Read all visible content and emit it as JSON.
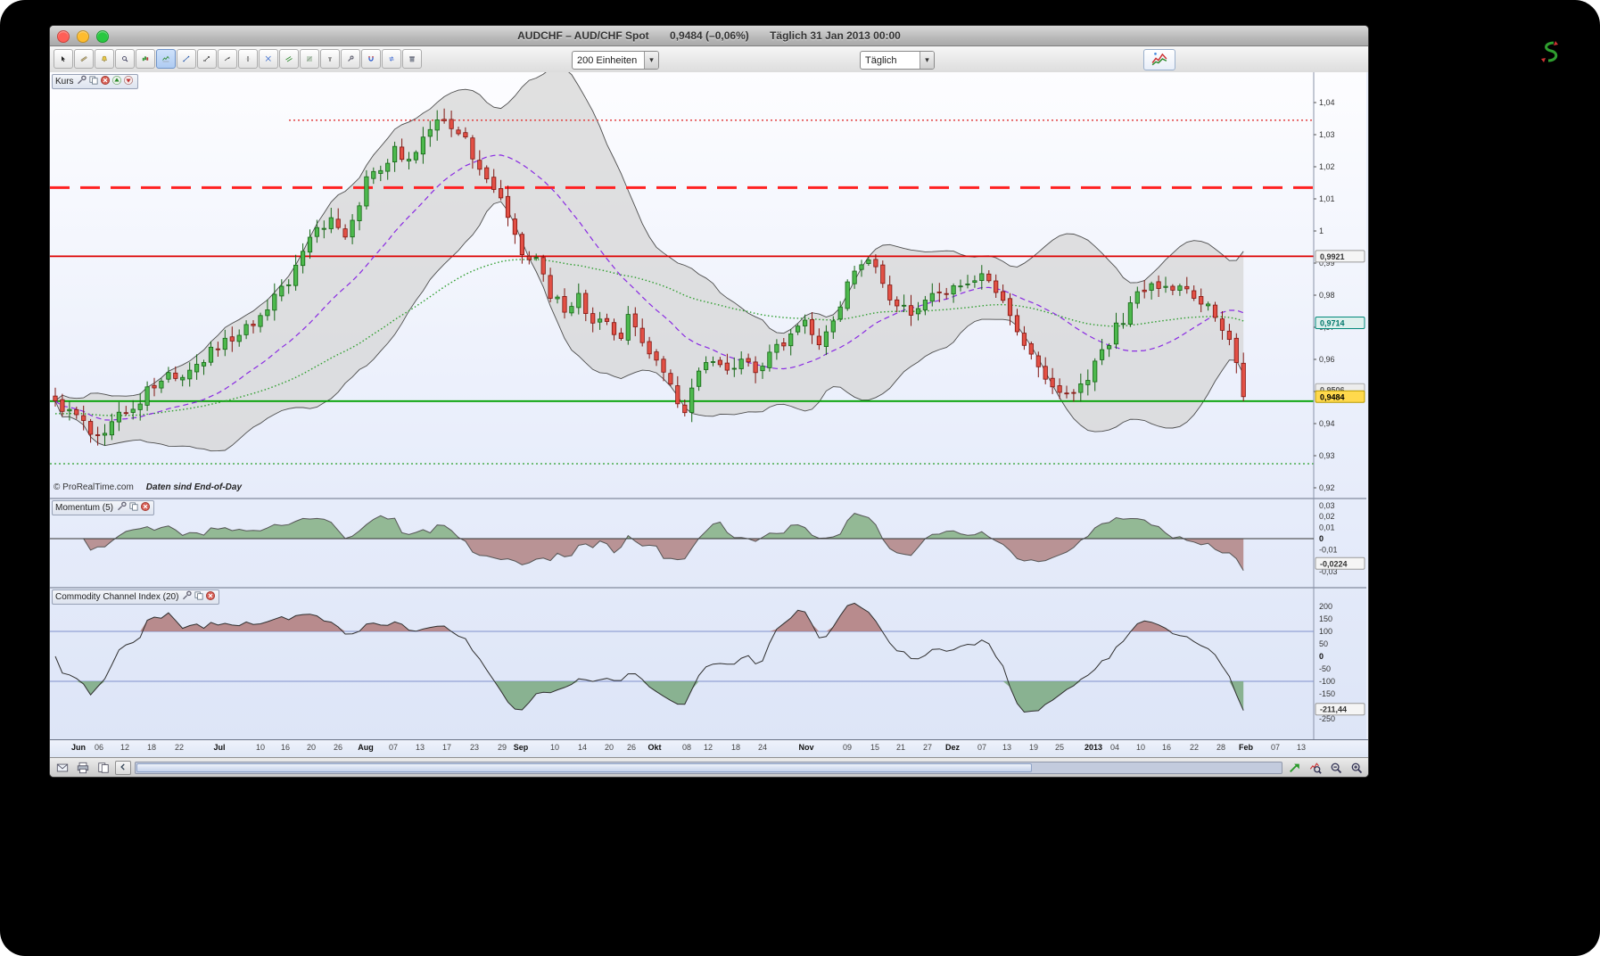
{
  "window": {
    "title_symbol": "AUDCHF – AUD/CHF Spot",
    "title_price": "0,9484 (–0,06%)",
    "title_timeframe": "Täglich  31 Jan 2013 00:00"
  },
  "toolbar": {
    "units_value": "200 Einheiten",
    "timeframe_value": "Täglich",
    "icons": [
      {
        "name": "cursor"
      },
      {
        "name": "measure"
      },
      {
        "name": "alert"
      },
      {
        "name": "zoom"
      },
      {
        "name": "pattern"
      },
      {
        "name": "indicator",
        "active": true
      },
      {
        "name": "trend-line"
      },
      {
        "name": "segment"
      },
      {
        "name": "ray"
      },
      {
        "name": "vertical-line"
      },
      {
        "name": "cross-lines"
      },
      {
        "name": "channel"
      },
      {
        "name": "fibonacci"
      },
      {
        "name": "text"
      },
      {
        "name": "tools"
      },
      {
        "name": "magnet"
      },
      {
        "name": "sync"
      },
      {
        "name": "delete"
      }
    ]
  },
  "panels": {
    "kurs": {
      "label": "Kurs",
      "icons": [
        "wrench-small",
        "copy-small",
        "close-small",
        "up-small",
        "down-small"
      ]
    },
    "momentum": {
      "label": "Momentum (5)",
      "icons": [
        "wrench-small",
        "copy-small",
        "close-small"
      ]
    },
    "cci": {
      "label": "Commodity Channel Index (20)",
      "icons": [
        "wrench-small",
        "copy-small",
        "close-small"
      ]
    }
  },
  "watermark": {
    "copyright": "© ProRealTime.com",
    "note": "Daten sind End-of-Day"
  },
  "statusbar": {
    "left_icons": [
      "envelope",
      "printer",
      "pages"
    ],
    "right_icons": [
      "green-arrow",
      "chart-zoom",
      "zoom-out",
      "zoom-in"
    ]
  },
  "chart_data": {
    "type": "candlestick",
    "symbol": "AUD/CHF Spot",
    "timeframe": "Täglich",
    "last_close": 0.9484,
    "bars": 169,
    "close_anchors": [
      [
        0,
        0.947
      ],
      [
        2,
        0.944
      ],
      [
        5,
        0.938
      ],
      [
        7,
        0.9365
      ],
      [
        9,
        0.942
      ],
      [
        12,
        0.948
      ],
      [
        15,
        0.955
      ],
      [
        18,
        0.956
      ],
      [
        20,
        0.959
      ],
      [
        23,
        0.964
      ],
      [
        26,
        0.968
      ],
      [
        28,
        0.97
      ],
      [
        30,
        0.976
      ],
      [
        33,
        0.985
      ],
      [
        35,
        0.993
      ],
      [
        37,
        1.0
      ],
      [
        39,
        1.005
      ],
      [
        41,
        0.998
      ],
      [
        44,
        1.015
      ],
      [
        46,
        1.02
      ],
      [
        48,
        1.025
      ],
      [
        50,
        1.022
      ],
      [
        52,
        1.03
      ],
      [
        54,
        1.034
      ],
      [
        56,
        1.032
      ],
      [
        58,
        1.028
      ],
      [
        60,
        1.018
      ],
      [
        62,
        1.012
      ],
      [
        64,
        1.005
      ],
      [
        66,
        0.993
      ],
      [
        68,
        0.99
      ],
      [
        70,
        0.98
      ],
      [
        72,
        0.976
      ],
      [
        74,
        0.979
      ],
      [
        76,
        0.97
      ],
      [
        78,
        0.972
      ],
      [
        80,
        0.966
      ],
      [
        81,
        0.973
      ],
      [
        84,
        0.963
      ],
      [
        86,
        0.956
      ],
      [
        88,
        0.947
      ],
      [
        89,
        0.944
      ],
      [
        91,
        0.956
      ],
      [
        93,
        0.96
      ],
      [
        95,
        0.957
      ],
      [
        97,
        0.959
      ],
      [
        99,
        0.956
      ],
      [
        101,
        0.961
      ],
      [
        103,
        0.965
      ],
      [
        105,
        0.969
      ],
      [
        106,
        0.972
      ],
      [
        108,
        0.965
      ],
      [
        110,
        0.971
      ],
      [
        112,
        0.985
      ],
      [
        114,
        0.99
      ],
      [
        115,
        0.992
      ],
      [
        117,
        0.983
      ],
      [
        119,
        0.976
      ],
      [
        121,
        0.975
      ],
      [
        123,
        0.978
      ],
      [
        125,
        0.98
      ],
      [
        127,
        0.982
      ],
      [
        129,
        0.985
      ],
      [
        131,
        0.986
      ],
      [
        133,
        0.98
      ],
      [
        134,
        0.977
      ],
      [
        136,
        0.97
      ],
      [
        138,
        0.96
      ],
      [
        140,
        0.953
      ],
      [
        142,
        0.948
      ],
      [
        144,
        0.95
      ],
      [
        146,
        0.953
      ],
      [
        147,
        0.96
      ],
      [
        149,
        0.965
      ],
      [
        150,
        0.97
      ],
      [
        152,
        0.976
      ],
      [
        153,
        0.98
      ],
      [
        155,
        0.984
      ],
      [
        157,
        0.983
      ],
      [
        159,
        0.982
      ],
      [
        161,
        0.98
      ],
      [
        163,
        0.976
      ],
      [
        164,
        0.972
      ],
      [
        166,
        0.968
      ],
      [
        167,
        0.96
      ],
      [
        168,
        0.9484
      ]
    ],
    "indicators": {
      "bollinger_period": 20,
      "bollinger_mult": 2.1,
      "slow_ma_period": 70,
      "momentum_period": 5,
      "cci_period": 20
    },
    "hlines": [
      {
        "value": 1.0345,
        "style": "dotted",
        "color": "#e03030",
        "width": 1.4,
        "from_frac": 0.19
      },
      {
        "value": 1.0135,
        "style": "dashed",
        "color": "#ff2222",
        "width": 3,
        "from_frac": 0
      },
      {
        "value": 0.9921,
        "style": "solid",
        "color": "#dd0000",
        "width": 1.8,
        "from_frac": 0
      },
      {
        "value": 0.947,
        "style": "solid",
        "color": "#00a000",
        "width": 1.8,
        "from_frac": 0
      },
      {
        "value": 0.9275,
        "style": "dotted",
        "color": "#2aa02a",
        "width": 1.2,
        "from_frac": 0
      }
    ],
    "price_axis": {
      "ticks": [
        {
          "t": "1,04",
          "v": 1.04
        },
        {
          "t": "1,03",
          "v": 1.03
        },
        {
          "t": "1,02",
          "v": 1.02
        },
        {
          "t": "1,01",
          "v": 1.01
        },
        {
          "t": "1",
          "v": 1.0
        },
        {
          "t": "0,99",
          "v": 0.99
        },
        {
          "t": "0,98",
          "v": 0.98
        },
        {
          "t": "0,97",
          "v": 0.97
        },
        {
          "t": "0,96",
          "v": 0.96
        },
        {
          "t": "0,95",
          "v": 0.95
        },
        {
          "t": "0,94",
          "v": 0.94
        },
        {
          "t": "0,93",
          "v": 0.93
        },
        {
          "t": "0,92",
          "v": 0.92
        }
      ],
      "badges": [
        {
          "text": "0,9921",
          "value": 0.9921,
          "bg": "#f5f5f5",
          "fg": "#333",
          "border": "#999"
        },
        {
          "text": "0,9714",
          "value": 0.9714,
          "bg": "#def0ed",
          "fg": "#00776b",
          "border": "#00887a"
        },
        {
          "text": "0,9506",
          "value": 0.9506,
          "bg": "#ededed",
          "fg": "#555",
          "border": "#aaa"
        },
        {
          "text": "0,9484",
          "value": 0.9484,
          "bg": "#ffd94d",
          "fg": "#000",
          "border": "#b89a00"
        }
      ]
    },
    "momentum_axis": {
      "ticks": [
        {
          "t": "0,03",
          "v": 0.03
        },
        {
          "t": "0,02",
          "v": 0.02
        },
        {
          "t": "0,01",
          "v": 0.01
        },
        {
          "t": "0",
          "v": 0,
          "bold": true
        },
        {
          "t": "-0,01",
          "v": -0.01
        },
        {
          "t": "-0,02",
          "v": -0.02
        },
        {
          "t": "-0,03",
          "v": -0.03
        }
      ],
      "badge": {
        "text": "-0,0224",
        "value": -0.0224,
        "bg": "#f5f5f5",
        "fg": "#333",
        "border": "#999"
      }
    },
    "cci_axis": {
      "ticks": [
        {
          "t": "200",
          "v": 200
        },
        {
          "t": "150",
          "v": 150
        },
        {
          "t": "100",
          "v": 100
        },
        {
          "t": "50",
          "v": 50
        },
        {
          "t": "0",
          "v": 0,
          "bold": true
        },
        {
          "t": "-50",
          "v": -50
        },
        {
          "t": "-100",
          "v": -100
        },
        {
          "t": "-150",
          "v": -150
        },
        {
          "t": "-250",
          "v": -250
        }
      ],
      "badge": {
        "text": "-211,44",
        "value": -211.44,
        "bg": "#f5f5f5",
        "fg": "#333",
        "border": "#999"
      },
      "guide_lines": [
        100,
        -100
      ]
    },
    "x_axis": {
      "labels": [
        {
          "t": "Jun",
          "f": 0.02,
          "b": true
        },
        {
          "t": "06",
          "f": 0.036
        },
        {
          "t": "12",
          "f": 0.057
        },
        {
          "t": "18",
          "f": 0.078
        },
        {
          "t": "22",
          "f": 0.1
        },
        {
          "t": "Jul",
          "f": 0.132,
          "b": true
        },
        {
          "t": "10",
          "f": 0.164
        },
        {
          "t": "16",
          "f": 0.184
        },
        {
          "t": "20",
          "f": 0.205
        },
        {
          "t": "26",
          "f": 0.226
        },
        {
          "t": "Aug",
          "f": 0.248,
          "b": true
        },
        {
          "t": "07",
          "f": 0.27
        },
        {
          "t": "13",
          "f": 0.291
        },
        {
          "t": "17",
          "f": 0.312
        },
        {
          "t": "23",
          "f": 0.334
        },
        {
          "t": "29",
          "f": 0.356
        },
        {
          "t": "Sep",
          "f": 0.371,
          "b": true
        },
        {
          "t": "10",
          "f": 0.398
        },
        {
          "t": "14",
          "f": 0.42
        },
        {
          "t": "20",
          "f": 0.441
        },
        {
          "t": "26",
          "f": 0.459
        },
        {
          "t": "Okt",
          "f": 0.477,
          "b": true
        },
        {
          "t": "08",
          "f": 0.503
        },
        {
          "t": "12",
          "f": 0.52
        },
        {
          "t": "18",
          "f": 0.542
        },
        {
          "t": "24",
          "f": 0.563
        },
        {
          "t": "Nov",
          "f": 0.598,
          "b": true
        },
        {
          "t": "09",
          "f": 0.63
        },
        {
          "t": "15",
          "f": 0.652
        },
        {
          "t": "21",
          "f": 0.673
        },
        {
          "t": "27",
          "f": 0.694
        },
        {
          "t": "Dez",
          "f": 0.714,
          "b": true
        },
        {
          "t": "07",
          "f": 0.737
        },
        {
          "t": "13",
          "f": 0.757
        },
        {
          "t": "19",
          "f": 0.778
        },
        {
          "t": "25",
          "f": 0.799
        },
        {
          "t": "2013",
          "f": 0.826,
          "b": true
        },
        {
          "t": "04",
          "f": 0.843
        },
        {
          "t": "10",
          "f": 0.863
        },
        {
          "t": "16",
          "f": 0.884
        },
        {
          "t": "22",
          "f": 0.906
        },
        {
          "t": "28",
          "f": 0.927
        },
        {
          "t": "Feb",
          "f": 0.947,
          "b": true
        },
        {
          "t": "07",
          "f": 0.97
        },
        {
          "t": "13",
          "f": 0.991
        }
      ]
    },
    "colors": {
      "candle_up_fill": "#4db84d",
      "candle_up_stroke": "#156615",
      "candle_down_fill": "#e25045",
      "candle_down_stroke": "#801510",
      "band_fill": "#d7d7d7",
      "band_stroke": "#4d4d4d",
      "sma_color": "#8a2be2",
      "slow_ma_color": "#2f9e2f",
      "momentum_pos": "#8ab48a",
      "momentum_neg": "#b48a8a",
      "cci_above": "#b07a7a",
      "cci_below": "#7aa87f"
    }
  }
}
